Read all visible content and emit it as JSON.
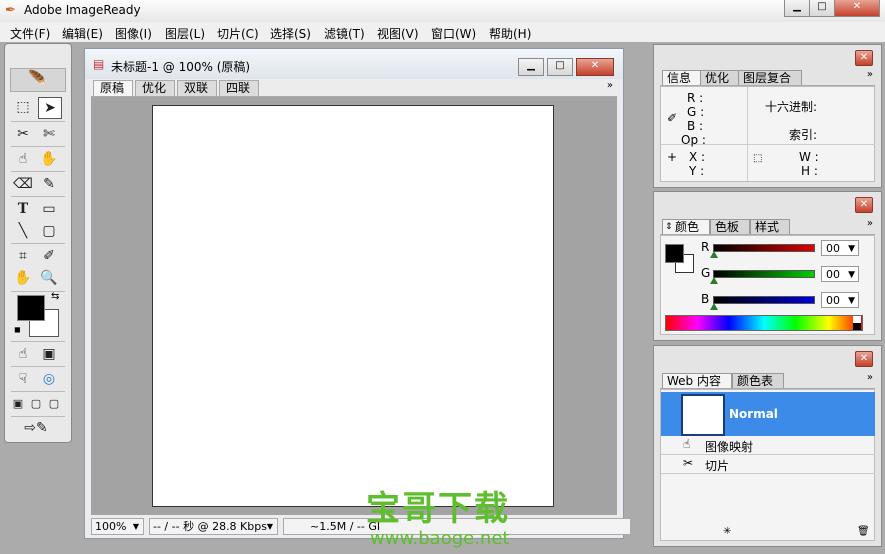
{
  "app": {
    "title": "Adobe ImageReady"
  },
  "window_controls": {
    "minimize": "▁",
    "maximize": "□",
    "close": "✕"
  },
  "menu": [
    "文件(F)",
    "编辑(E)",
    "图像(I)",
    "图层(L)",
    "切片(C)",
    "选择(S)",
    "滤镜(T)",
    "视图(V)",
    "窗口(W)",
    "帮助(H)"
  ],
  "document": {
    "title": "未标题-1 @ 100% (原稿)",
    "tabs": [
      "原稿",
      "优化",
      "双联",
      "四联"
    ],
    "zoom": "100%",
    "download_time": "-- / -- 秒 @ 28.8 Kbps",
    "size_info": "~1.5M / -- GI"
  },
  "info_panel": {
    "tabs": [
      "信息",
      "优化",
      "图层复合"
    ],
    "rgb_labels": [
      "R :",
      "G :",
      "B :",
      "Op :"
    ],
    "hex_label": "十六进制:",
    "index_label": "索引:",
    "xy_labels": [
      "X :",
      "Y :"
    ],
    "wh_labels": [
      "W :",
      "H :"
    ]
  },
  "color_panel": {
    "tabs": [
      "颜色",
      "色板",
      "样式"
    ],
    "channels": [
      {
        "label": "R",
        "value": "00",
        "color": "#cc0000"
      },
      {
        "label": "G",
        "value": "00",
        "color": "#00a000"
      },
      {
        "label": "B",
        "value": "00",
        "color": "#0000cc"
      }
    ]
  },
  "web_panel": {
    "tabs": [
      "Web 内容",
      "颜色表"
    ],
    "selected_item": "Normal",
    "items": [
      "图像映射",
      "切片"
    ],
    "accent_color": "#3d8be8"
  },
  "colors": {
    "foreground": "#000000",
    "background": "#ffffff"
  },
  "watermark": {
    "title": "宝哥下载",
    "url": "www.baoge.net"
  }
}
